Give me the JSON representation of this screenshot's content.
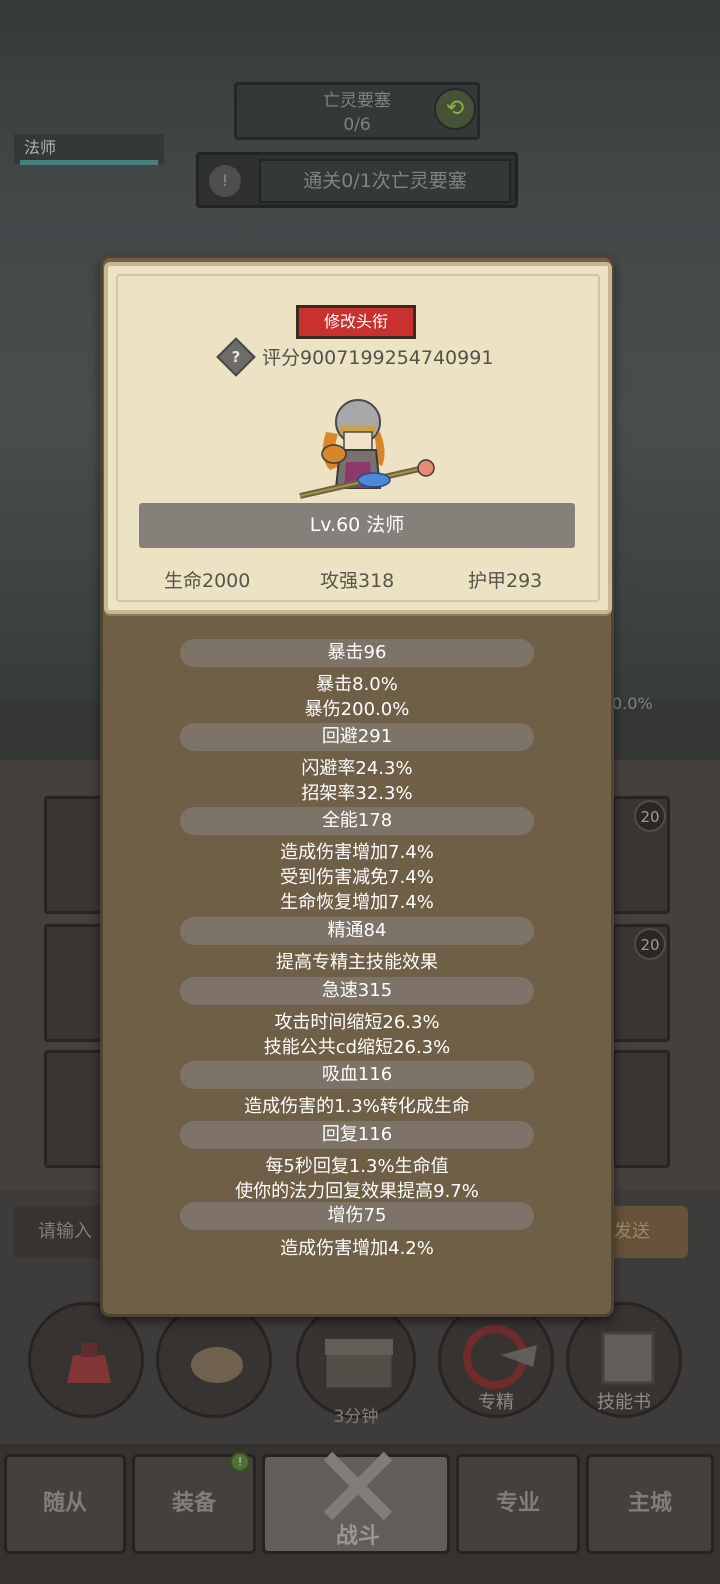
{
  "background": {
    "zone_name": "亡灵要塞",
    "zone_progress": "0/6",
    "quest_text": "通关0/1次亡灵要塞",
    "class_tag": "法师",
    "right_percent": "0.0%",
    "slot_badges": [
      "20",
      "20"
    ],
    "input_placeholder": "请输入",
    "send_label": "发送",
    "circle_buttons": [
      {
        "label": ""
      },
      {
        "label": ""
      },
      {
        "label": "3分钟"
      },
      {
        "label": "专精"
      },
      {
        "label": "技能书"
      }
    ],
    "nav": [
      {
        "label": "随从"
      },
      {
        "label": "装备"
      },
      {
        "label": "战斗"
      },
      {
        "label": "专业"
      },
      {
        "label": "主城"
      }
    ]
  },
  "modal": {
    "change_title_label": "修改头衔",
    "score": "评分9007199254740991",
    "level_label": "Lv.60 法师",
    "hp": "生命2000",
    "atk": "攻强318",
    "armor": "护甲293",
    "sections": [
      {
        "title": "暴击96",
        "lines": [
          "暴击8.0%",
          "暴伤200.0%"
        ]
      },
      {
        "title": "回避291",
        "lines": [
          "闪避率24.3%",
          "招架率32.3%"
        ]
      },
      {
        "title": "全能178",
        "lines": [
          "造成伤害增加7.4%",
          "受到伤害减免7.4%",
          "生命恢复增加7.4%"
        ]
      },
      {
        "title": "精通84",
        "lines": [
          "提高专精主技能效果"
        ]
      },
      {
        "title": "急速315",
        "lines": [
          "攻击时间缩短26.3%",
          "技能公共cd缩短26.3%"
        ]
      },
      {
        "title": "吸血116",
        "lines": [
          "造成伤害的1.3%转化成生命"
        ]
      },
      {
        "title": "回复116",
        "lines": [
          "每5秒回复1.3%生命值",
          "使你的法力回复效果提高9.7%"
        ]
      },
      {
        "title": "增伤75",
        "lines": [
          "造成伤害增加4.2%"
        ]
      }
    ]
  },
  "colors": {
    "modal_bg": "#6f5f46",
    "card_bg": "#ece3c5",
    "title_btn": "#c8312e",
    "section_bar": "#7d7367"
  }
}
